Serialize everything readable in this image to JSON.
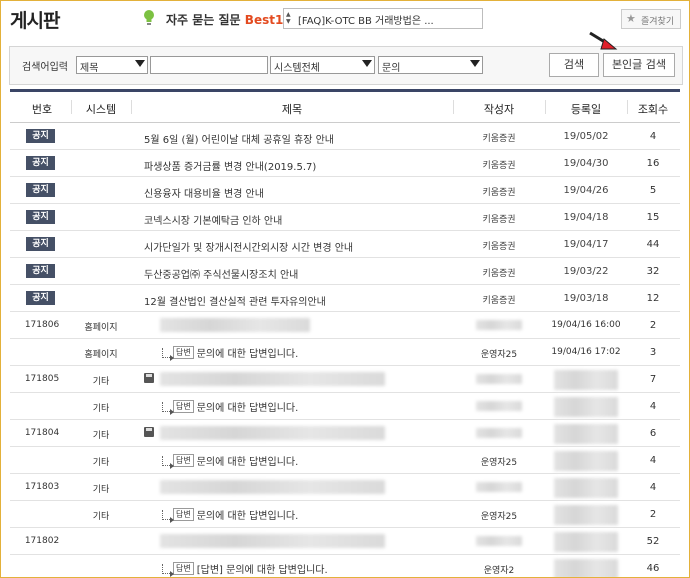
{
  "page_title": "게시판",
  "faq": {
    "label": "자주 묻는 질문",
    "best_label": "Best10",
    "current_item": "[FAQ]K-OTC BB 거래방법은 ..."
  },
  "favorite_label": "즐겨찾기",
  "search": {
    "label": "검색어입력",
    "field_select": "제목",
    "keyword_value": "",
    "system_select": "시스템전체",
    "type_select": "문의",
    "search_button": "검색",
    "my_posts_button": "본인글 검색"
  },
  "columns": [
    "번호",
    "시스템",
    "제목",
    "작성자",
    "등록일",
    "조회수"
  ],
  "notice_badge": "공지",
  "reply_tag": "답변",
  "notices": [
    {
      "title": "5월 6일 (월) 어린이날 대체 공휴일 휴장 안내",
      "author": "키움증권",
      "date": "19/05/02",
      "views": "4"
    },
    {
      "title": "파생상품 증거금률 변경 안내(2019.5.7)",
      "author": "키움증권",
      "date": "19/04/30",
      "views": "16"
    },
    {
      "title": "신용융자 대용비율 변경 안내",
      "author": "키움증권",
      "date": "19/04/26",
      "views": "5"
    },
    {
      "title": "코넥스시장 기본예탁금 인하 안내",
      "author": "키움증권",
      "date": "19/04/18",
      "views": "15"
    },
    {
      "title": "시가단일가 및 장개시전시간외시장 시간 변경 안내",
      "author": "키움증권",
      "date": "19/04/17",
      "views": "44"
    },
    {
      "title": "두산중공업㈜ 주식선물시장조치 안내",
      "author": "키움증권",
      "date": "19/03/22",
      "views": "32"
    },
    {
      "title": "12월 결산법인 결산실적 관련 투자유의안내",
      "author": "키움증권",
      "date": "19/03/18",
      "views": "12"
    }
  ],
  "posts": [
    {
      "no": "171806",
      "system": "홈페이지",
      "title": "",
      "author": "",
      "date": "19/04/16 16:00",
      "views": "2",
      "reply": false
    },
    {
      "no": "",
      "system": "홈페이지",
      "title": "문의에 대한 답변입니다.",
      "author": "운영자25",
      "date": "19/04/16 17:02",
      "views": "3",
      "reply": true
    },
    {
      "no": "171805",
      "system": "기타",
      "title": "",
      "author": "",
      "date": "",
      "views": "7",
      "reply": false
    },
    {
      "no": "",
      "system": "기타",
      "title": "문의에 대한 답변입니다.",
      "author": "",
      "date": "",
      "views": "4",
      "reply": true
    },
    {
      "no": "171804",
      "system": "기타",
      "title": "",
      "author": "",
      "date": "",
      "views": "6",
      "reply": false
    },
    {
      "no": "",
      "system": "기타",
      "title": "문의에 대한 답변입니다.",
      "author": "운영자25",
      "date": "",
      "views": "4",
      "reply": true
    },
    {
      "no": "171803",
      "system": "기타",
      "title": "",
      "author": "",
      "date": "",
      "views": "4",
      "reply": false
    },
    {
      "no": "",
      "system": "기타",
      "title": "문의에 대한 답변입니다.",
      "author": "운영자25",
      "date": "",
      "views": "2",
      "reply": true
    },
    {
      "no": "171802",
      "system": "",
      "title": "",
      "author": "",
      "date": "",
      "views": "52",
      "reply": false
    },
    {
      "no": "",
      "system": "",
      "title": "[답변] 문의에 대한 답변입니다.",
      "author": "운영자2",
      "date": "",
      "views": "46",
      "reply": true
    }
  ],
  "colors": {
    "border": "#e3b13a",
    "header_line": "#3a4566",
    "badge": "#455066",
    "best": "#e34a1f"
  }
}
